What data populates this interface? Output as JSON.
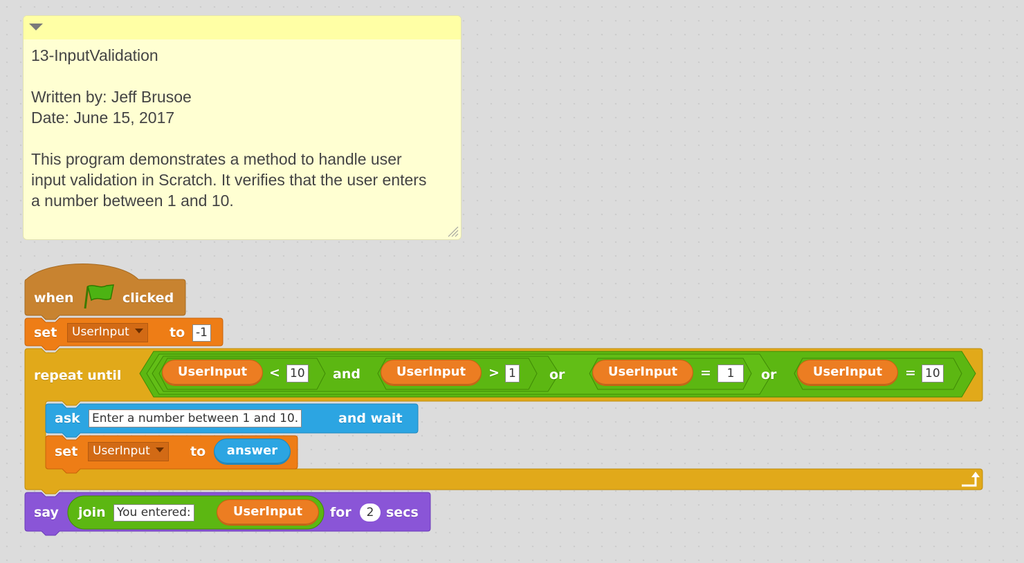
{
  "comment": {
    "text": "13-InputValidation\n\nWritten by: Jeff Brusoe\nDate: June 15, 2017\n\nThis program demonstrates a method to handle user\ninput validation in Scratch. It verifies that the user enters\na number between 1 and 10."
  },
  "hat": {
    "when": "when",
    "clicked": "clicked",
    "icon": "green-flag-icon"
  },
  "set1": {
    "set": "set",
    "variable": "UserInput",
    "to": "to",
    "value": "-1"
  },
  "repeat": {
    "label": "repeat until",
    "cond1": {
      "var": "UserInput",
      "op": "<",
      "value": "10"
    },
    "and": "and",
    "cond2": {
      "var": "UserInput",
      "op": ">",
      "value": "1"
    },
    "or1": "or",
    "cond3": {
      "var": "UserInput",
      "op": "=",
      "value": "1"
    },
    "or2": "or",
    "cond4": {
      "var": "UserInput",
      "op": "=",
      "value": "10"
    }
  },
  "ask": {
    "ask": "ask",
    "question": "Enter a number between 1 and 10.",
    "and_wait": "and wait"
  },
  "set2": {
    "set": "set",
    "variable": "UserInput",
    "to": "to",
    "answer": "answer"
  },
  "say": {
    "say": "say",
    "join": "join",
    "text": "You entered:",
    "var": "UserInput",
    "for": "for",
    "secs_value": "2",
    "secs": "secs"
  },
  "colors": {
    "events": "#c88330",
    "data": "#ee7d16",
    "control": "#e1a91a",
    "operators": "#5cb712",
    "sensing": "#2ca5e2",
    "looks": "#8a55d7"
  }
}
